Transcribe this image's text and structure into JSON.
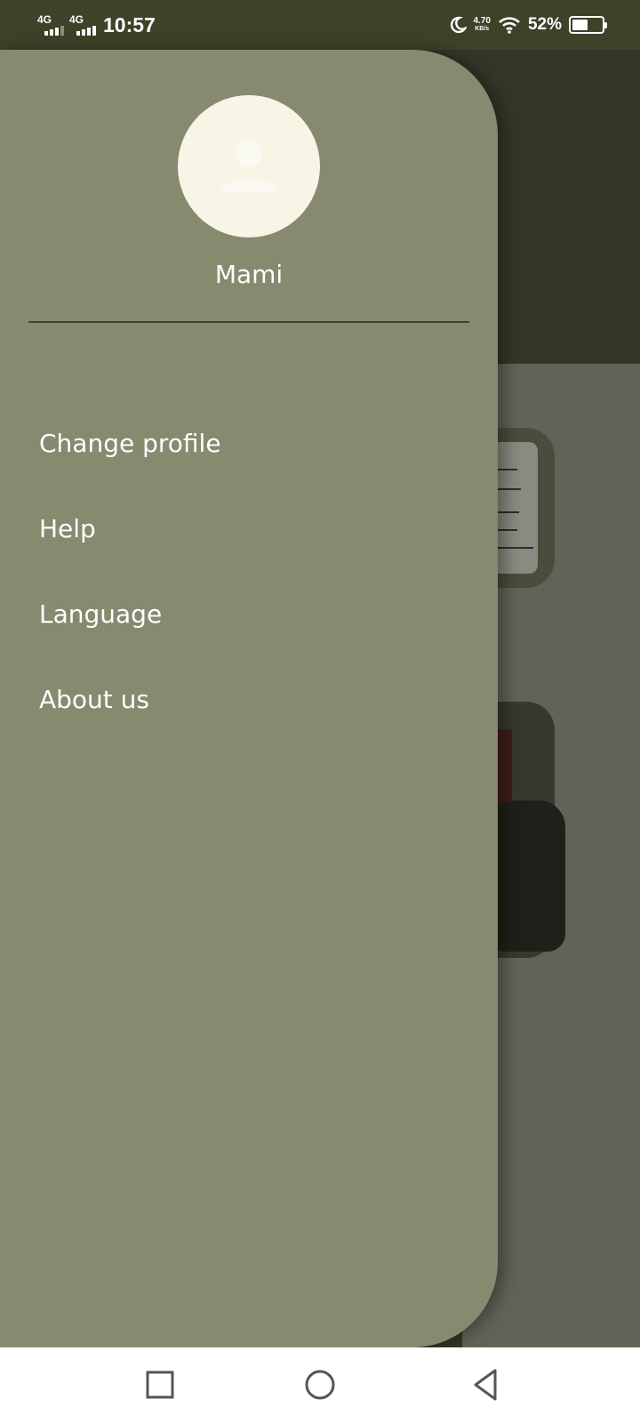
{
  "status_bar": {
    "network_1": "4G",
    "network_2": "4G",
    "time": "10:57",
    "speed_value": "4.70",
    "speed_unit": "KB/s",
    "battery_percent": "52%",
    "battery_level": 0.52,
    "icons": [
      "signal-icon",
      "moon-icon",
      "wifi-icon",
      "battery-icon"
    ]
  },
  "drawer": {
    "avatar_icon": "person-icon",
    "user_name": "Mami",
    "menu": [
      {
        "label": "Change profile"
      },
      {
        "label": "Help"
      },
      {
        "label": "Language"
      },
      {
        "label": "About us"
      }
    ]
  },
  "nav_bar": {
    "icons": [
      "recent-apps-icon",
      "home-icon",
      "back-icon"
    ]
  },
  "colors": {
    "drawer": "#868a6f",
    "status_bar": "#3f4128",
    "avatar_bg": "#f8f5e6",
    "divider": "#3f4232"
  }
}
